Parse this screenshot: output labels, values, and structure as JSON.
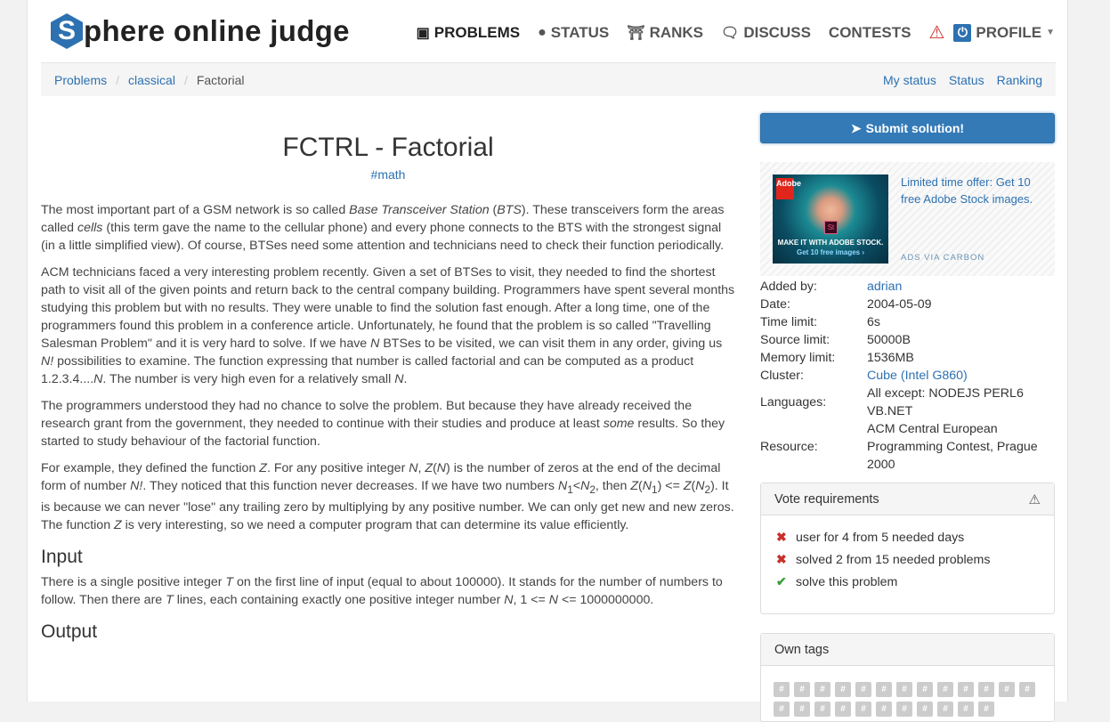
{
  "brand": {
    "logo_letter": "S",
    "logo_text": "phere online judge"
  },
  "nav": [
    {
      "label": "PROBLEMS",
      "icon": "puzzle-icon"
    },
    {
      "label": "STATUS",
      "icon": "circle-icon"
    },
    {
      "label": "RANKS",
      "icon": "trophy-icon"
    },
    {
      "label": "DISCUSS",
      "icon": "chat-icon"
    },
    {
      "label": "CONTESTS",
      "icon": ""
    },
    {
      "label": "PROFILE",
      "icon": "power-icon"
    }
  ],
  "breadcrumb": {
    "items": [
      "Problems",
      "classical",
      "Factorial"
    ],
    "right": [
      "My status",
      "Status",
      "Ranking"
    ]
  },
  "problem": {
    "title": "FCTRL - Factorial",
    "tag": "#math",
    "p1": {
      "a": "The most important part of a GSM network is so called ",
      "b": "Base Transceiver Station",
      "c": " (",
      "d": "BTS",
      "e": "). These transceivers form the areas called ",
      "f": "cells",
      "g": " (this term gave the name to the cellular phone) and every phone connects to the BTS with the strongest signal (in a little simplified view). Of course, BTSes need some attention and technicians need to check their function periodically."
    },
    "p2": {
      "a": "ACM technicians faced a very interesting problem recently. Given a set of BTSes to visit, they needed to find the shortest path to visit all of the given points and return back to the central company building. Programmers have spent several months studying this problem but with no results. They were unable to find the solution fast enough. After a long time, one of the programmers found this problem in a conference article. Unfortunately, he found that the problem is so called \"Travelling Salesman Problem\" and it is very hard to solve. If we have ",
      "b": "N",
      "c": " BTSes to be visited, we can visit them in any order, giving us ",
      "d": "N!",
      "e": " possibilities to examine. The function expressing that number is called factorial and can be computed as a product 1.2.3.4....",
      "f": "N",
      "g": ". The number is very high even for a relatively small ",
      "h": "N",
      "i": "."
    },
    "p3": {
      "a": "The programmers understood they had no chance to solve the problem. But because they have already received the research grant from the government, they needed to continue with their studies and produce at least ",
      "b": "some",
      "c": " results. So they started to study behaviour of the factorial function."
    },
    "p4": {
      "a": "For example, they defined the function ",
      "b": "Z",
      "c": ". For any positive integer ",
      "d": "N",
      "e": ", ",
      "f": "Z",
      "g": "(",
      "h": "N",
      "i": ") is the number of zeros at the end of the decimal form of number ",
      "j": "N!",
      "k": ". They noticed that this function never decreases. If we have two numbers ",
      "l": "N",
      "l_sub": "1",
      "m": "<",
      "n": "N",
      "n_sub": "2",
      "o": ", then ",
      "p": "Z",
      "q": "(",
      "r": "N",
      "r_sub": "1",
      "s": ") <= ",
      "t": "Z",
      "u": "(",
      "v": "N",
      "v_sub": "2",
      "w": "). It is because we can never \"lose\" any trailing zero by multiplying by any positive number. We can only get new and new zeros. The function ",
      "x": "Z",
      "y": " is very interesting, so we need a computer program that can determine its value efficiently."
    },
    "input_heading": "Input",
    "input": {
      "a": "There is a single positive integer ",
      "b": "T",
      "c": " on the first line of input (equal to about 100000). It stands for the number of numbers to follow. Then there are ",
      "d": "T",
      "e": " lines, each containing exactly one positive integer number ",
      "f": "N",
      "g": ", 1 <= ",
      "h": "N",
      "i": " <= 1000000000."
    },
    "output_heading": "Output"
  },
  "sidebar": {
    "submit_label": "Submit solution!",
    "ad": {
      "brand": "Adobe",
      "badge": "St",
      "banner_line1": "MAKE IT WITH ADOBE STOCK.",
      "banner_line2": "Get 10 free images ›",
      "text": "Limited time offer: Get 10 free Adobe Stock images.",
      "via": "ADS VIA CARBON"
    },
    "info": {
      "added_by_label": "Added by:",
      "added_by": "adrian",
      "date_label": "Date:",
      "date": "2004-05-09",
      "time_limit_label": "Time limit:",
      "time_limit": "6s",
      "source_limit_label": "Source limit:",
      "source_limit": "50000B",
      "memory_limit_label": "Memory limit:",
      "memory_limit": "1536MB",
      "cluster_label": "Cluster:",
      "cluster": "Cube (Intel G860)",
      "languages_label": "Languages:",
      "languages_1": "All except: NODEJS PERL6",
      "languages_2": "VB.NET",
      "resource_label": "Resource:",
      "resource_1": "ACM Central European",
      "resource_2": "Programming Contest, Prague",
      "resource_3": "2000"
    },
    "vote": {
      "title": "Vote requirements",
      "items": [
        {
          "text": "user for 4 from 5 needed days",
          "status": "no"
        },
        {
          "text": "solved 2 from 15 needed problems",
          "status": "no"
        },
        {
          "text": "solve this problem",
          "status": "yes"
        }
      ]
    },
    "own_tags": {
      "title": "Own tags",
      "chip": "#"
    }
  }
}
